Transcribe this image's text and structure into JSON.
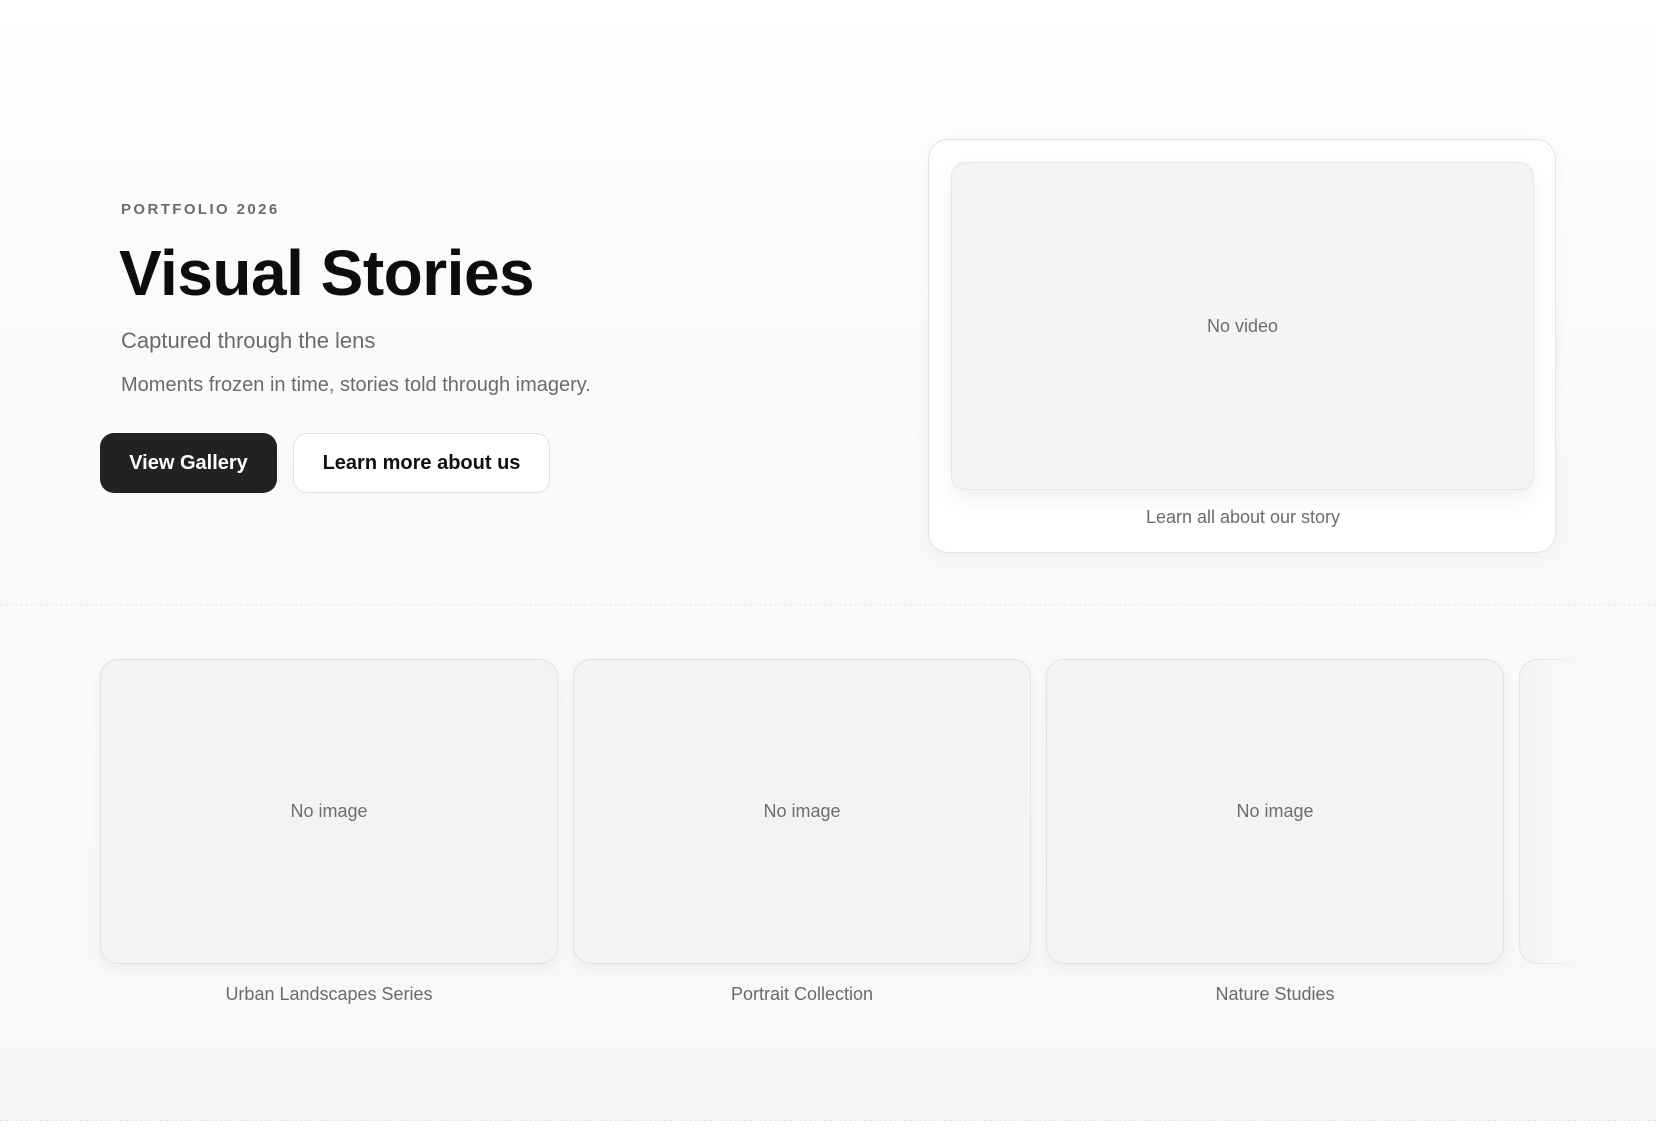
{
  "hero": {
    "eyebrow": "PORTFOLIO 2026",
    "title": "Visual Stories",
    "subtitle": "Captured through the lens",
    "description": "Moments frozen in time, stories told through imagery.",
    "primary_button": "View Gallery",
    "secondary_button": "Learn more about us"
  },
  "video": {
    "placeholder": "No video",
    "caption": "Learn all about our story"
  },
  "gallery": {
    "items": [
      {
        "placeholder": "No image",
        "caption": "Urban Landscapes Series"
      },
      {
        "placeholder": "No image",
        "caption": "Portrait Collection"
      },
      {
        "placeholder": "No image",
        "caption": "Nature Studies"
      }
    ]
  },
  "colors": {
    "primary_button_bg": "#222224",
    "text_muted": "#6b6b6b",
    "placeholder_bg": "#f3f3f3"
  }
}
